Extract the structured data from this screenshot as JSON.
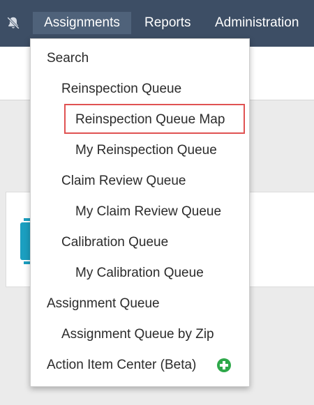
{
  "navbar": {
    "notifications_icon": "bell-slash-icon",
    "items": [
      "Assignments",
      "Reports",
      "Administration"
    ]
  },
  "menu": {
    "search": "Search",
    "reinspection_queue": "Reinspection Queue",
    "reinspection_queue_map": "Reinspection Queue Map",
    "my_reinspection_queue": "My Reinspection Queue",
    "claim_review_queue": "Claim Review Queue",
    "my_claim_review_queue": "My Claim Review Queue",
    "calibration_queue": "Calibration Queue",
    "my_calibration_queue": "My Calibration Queue",
    "assignment_queue": "Assignment Queue",
    "assignment_queue_by_zip": "Assignment Queue by Zip",
    "action_item_center": "Action Item Center (Beta)",
    "action_item_icon": "plus-circle-icon"
  },
  "colors": {
    "navbar": "#3d4e65",
    "active_tab": "#4f627a",
    "highlight_border": "#e05252",
    "add_icon": "#2ea84a",
    "card_icon": "#1b9fc0"
  }
}
